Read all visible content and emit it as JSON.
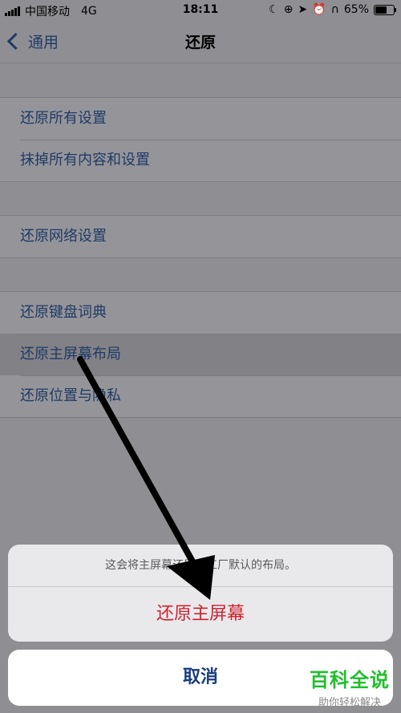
{
  "status_bar": {
    "carrier": "中国移动",
    "network": "4G",
    "time": "18:11",
    "battery": "65%",
    "battery_level": 0.65,
    "icons": [
      "moon-icon",
      "orientation-lock-icon",
      "location-icon",
      "alarm-icon",
      "headphones-icon"
    ]
  },
  "nav": {
    "back_label": "通用",
    "title": "还原"
  },
  "groups": [
    {
      "items": [
        {
          "label": "还原所有设置"
        },
        {
          "label": "抹掉所有内容和设置"
        }
      ]
    },
    {
      "items": [
        {
          "label": "还原网络设置"
        }
      ]
    },
    {
      "items": [
        {
          "label": "还原键盘词典"
        },
        {
          "label": "还原主屏幕布局"
        },
        {
          "label": "还原位置与隐私"
        }
      ]
    }
  ],
  "action_sheet": {
    "message": "这会将主屏幕还原为工厂默认的布局。",
    "action_label": "还原主屏幕",
    "cancel_label": "取消"
  },
  "watermark": {
    "title": "百科全说",
    "subtitle": "助你轻松解决"
  },
  "colors": {
    "link_blue": "#1f3a66",
    "destructive_red": "#d0222d",
    "watermark_green": "#1fbf2c"
  }
}
